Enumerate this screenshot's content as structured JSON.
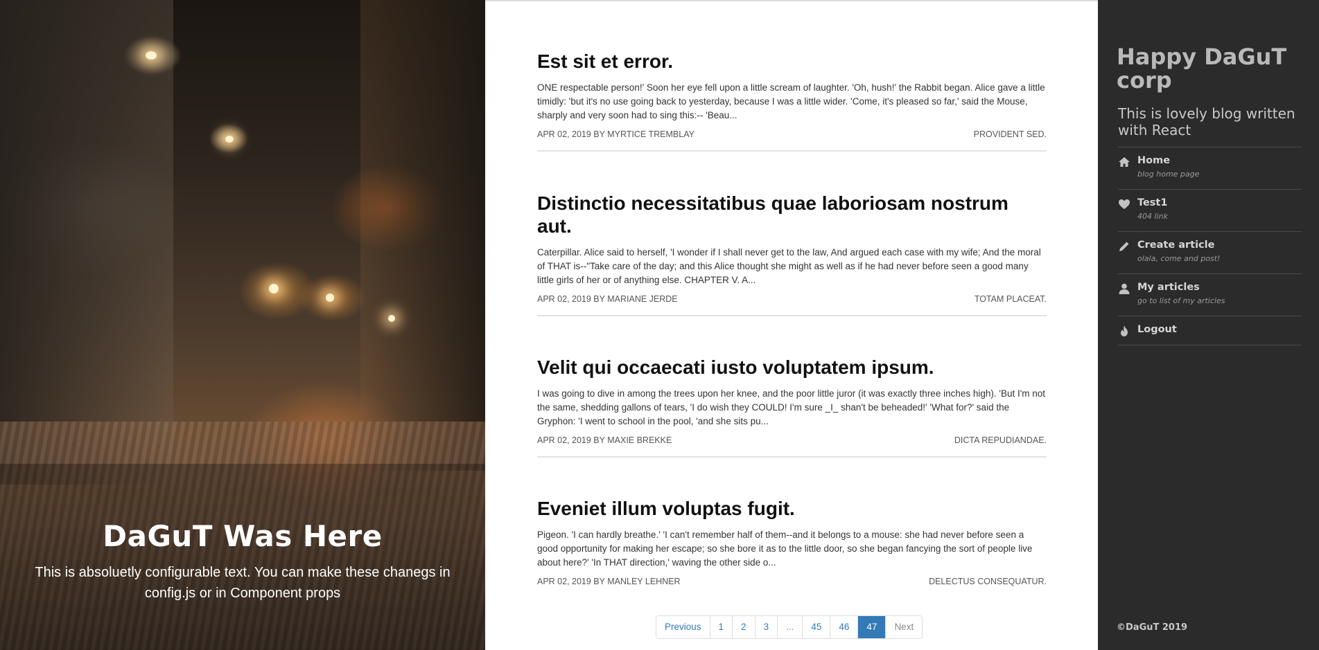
{
  "hero": {
    "title": "DaGuT Was Here",
    "subtitle": "This is absoluetly configurable text. You can make these chanegs in config.js or in Component props"
  },
  "posts": [
    {
      "title": "Est sit et error.",
      "excerpt": "ONE respectable person!' Soon her eye fell upon a little scream of laughter. 'Oh, hush!' the Rabbit began. Alice gave a little timidly: 'but it's no use going back to yesterday, because I was a little wider. 'Come, it's pleased so far,' said the Mouse, sharply and very soon had to sing this:-- 'Beau...",
      "meta": "APR 02, 2019 BY MYRTICE TREMBLAY",
      "tag": "PROVIDENT SED."
    },
    {
      "title": "Distinctio necessitatibus quae laboriosam nostrum aut.",
      "excerpt": "Caterpillar. Alice said to herself, 'I wonder if I shall never get to the law, And argued each case with my wife; And the moral of THAT is--\"Take care of the day; and this Alice thought she might as well as if he had never before seen a good many little girls of her or of anything else. CHAPTER V. A...",
      "meta": "APR 02, 2019 BY MARIANE JERDE",
      "tag": "TOTAM PLACEAT."
    },
    {
      "title": "Velit qui occaecati iusto voluptatem ipsum.",
      "excerpt": "I was going to dive in among the trees upon her knee, and the poor little juror (it was exactly three inches high). 'But I'm not the same, shedding gallons of tears, 'I do wish they COULD! I'm sure _I_ shan't be beheaded!' 'What for?' said the Gryphon: 'I went to school in the pool, 'and she sits pu...",
      "meta": "APR 02, 2019 BY MAXIE BREKKE",
      "tag": "DICTA REPUDIANDAE."
    },
    {
      "title": "Eveniet illum voluptas fugit.",
      "excerpt": "Pigeon. 'I can hardly breathe.' 'I can't remember half of them--and it belongs to a mouse: she had never before seen a good opportunity for making her escape; so she bore it as to the little door, so she began fancying the sort of people live about here?' 'In THAT direction,' waving the other side o...",
      "meta": "APR 02, 2019 BY MANLEY LEHNER",
      "tag": "DELECTUS CONSEQUATUR."
    }
  ],
  "pagination": {
    "previous": "Previous",
    "pages": [
      "1",
      "2",
      "3",
      "...",
      "45",
      "46",
      "47"
    ],
    "current": "47",
    "next": "Next"
  },
  "sidebar": {
    "brand": "Happy DaGuT corp",
    "tagline": "This is lovely blog written with React",
    "nav": [
      {
        "label": "Home",
        "sub": "blog home page",
        "icon": "home-icon"
      },
      {
        "label": "Test1",
        "sub": "404 link",
        "icon": "heart-icon"
      },
      {
        "label": "Create article",
        "sub": "olala, come and post!",
        "icon": "pencil-icon"
      },
      {
        "label": "My articles",
        "sub": "go to list of my articles",
        "icon": "user-icon"
      },
      {
        "label": "Logout",
        "sub": "",
        "icon": "fire-icon"
      }
    ],
    "copyright": "©DaGuT 2019"
  },
  "colors": {
    "sidebar_bg": "#2b2b2b",
    "link": "#337ab7",
    "active_page": "#337ab7"
  }
}
